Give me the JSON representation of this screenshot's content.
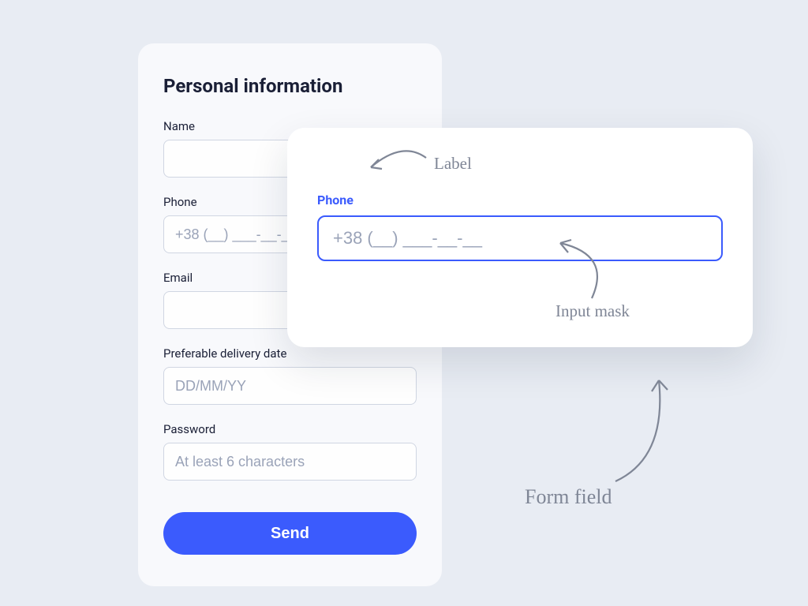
{
  "form": {
    "title": "Personal information",
    "fields": {
      "name": {
        "label": "Name",
        "placeholder": ""
      },
      "phone": {
        "label": "Phone",
        "placeholder": "+38 (__) ___-__-__"
      },
      "email": {
        "label": "Email",
        "placeholder": ""
      },
      "date": {
        "label": "Preferable delivery date",
        "placeholder": "DD/MM/YY"
      },
      "password": {
        "label": "Password",
        "placeholder": "At least 6 characters"
      }
    },
    "submit_label": "Send"
  },
  "callout": {
    "label": "Phone",
    "placeholder": "+38 (__) ___-__-__"
  },
  "annotations": {
    "label": "Label",
    "input_mask": "Input mask",
    "form_field": "Form field"
  }
}
